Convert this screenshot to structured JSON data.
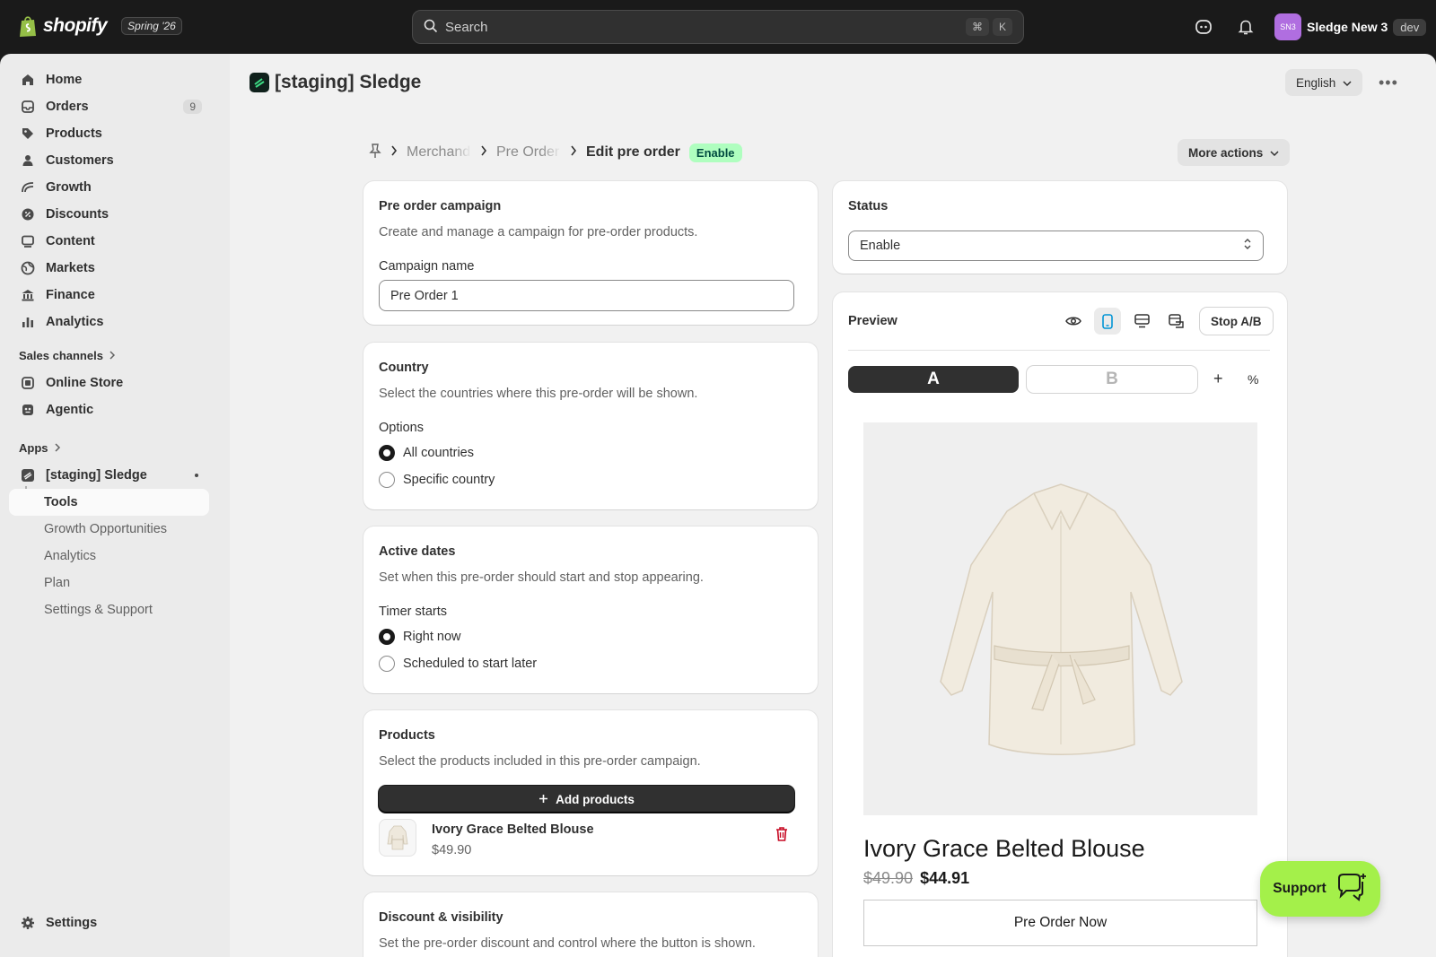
{
  "topbar": {
    "brand": "shopify",
    "edition_badge": "Spring '26",
    "search_placeholder": "Search",
    "search_shortcut": [
      "⌘",
      "K"
    ],
    "user": {
      "initials": "SN3",
      "name": "Sledge New 3",
      "env_badge": "dev"
    }
  },
  "sidebar": {
    "items": [
      {
        "label": "Home",
        "icon": "home-icon"
      },
      {
        "label": "Orders",
        "icon": "orders-icon",
        "count": "9"
      },
      {
        "label": "Products",
        "icon": "tag-icon"
      },
      {
        "label": "Customers",
        "icon": "person-icon"
      },
      {
        "label": "Growth",
        "icon": "growth-icon"
      },
      {
        "label": "Discounts",
        "icon": "discount-icon"
      },
      {
        "label": "Content",
        "icon": "content-icon"
      },
      {
        "label": "Markets",
        "icon": "globe-icon"
      },
      {
        "label": "Finance",
        "icon": "bank-icon"
      },
      {
        "label": "Analytics",
        "icon": "bar-chart-icon"
      }
    ],
    "sales_channels_header": "Sales channels",
    "channels": [
      {
        "label": "Online Store",
        "icon": "store-icon"
      },
      {
        "label": "Agentic",
        "icon": "agentic-icon"
      }
    ],
    "apps_header": "Apps",
    "app": {
      "label": "[staging] Sledge",
      "sub_items": [
        "Tools",
        "Growth Opportunities",
        "Analytics",
        "Plan",
        "Settings & Support"
      ],
      "active_sub": "Tools"
    },
    "settings_label": "Settings"
  },
  "header": {
    "app_title": "[staging] Sledge",
    "language": "English"
  },
  "breadcrumb": {
    "items": [
      "Merchandise",
      "Pre Order"
    ],
    "current": "Edit pre order",
    "status_badge": "Enable",
    "more_actions": "More actions"
  },
  "campaign": {
    "title": "Pre order campaign",
    "description": "Create and manage a campaign for pre-order products.",
    "name_label": "Campaign name",
    "name_value": "Pre Order 1"
  },
  "country": {
    "title": "Country",
    "description": "Select the countries where this pre-order will be shown.",
    "options_label": "Options",
    "options": [
      "All countries",
      "Specific country"
    ],
    "selected": "All countries"
  },
  "dates": {
    "title": "Active dates",
    "description": "Set when this pre-order should start and stop appearing.",
    "timer_label": "Timer starts",
    "options": [
      "Right now",
      "Scheduled to start later"
    ],
    "selected": "Right now"
  },
  "products": {
    "title": "Products",
    "description": "Select the products included in this pre-order campaign.",
    "add_button": "Add products",
    "item": {
      "name": "Ivory Grace Belted Blouse",
      "price": "$49.90"
    }
  },
  "discount": {
    "title": "Discount & visibility",
    "description": "Set the pre-order discount and control where the button is shown."
  },
  "status": {
    "title": "Status",
    "value": "Enable"
  },
  "preview": {
    "title": "Preview",
    "stop_ab": "Stop A/B",
    "variant_a": "A",
    "variant_b": "B",
    "add_symbol": "+",
    "percent_symbol": "%",
    "product_name": "Ivory Grace Belted Blouse",
    "old_price": "$49.90",
    "new_price": "$44.91",
    "button_label": "Pre Order Now"
  },
  "support": {
    "label": "Support"
  },
  "colors": {
    "accent_dark": "#303030",
    "badge_success_bg": "#affebf",
    "support_green": "#a4f04a"
  }
}
